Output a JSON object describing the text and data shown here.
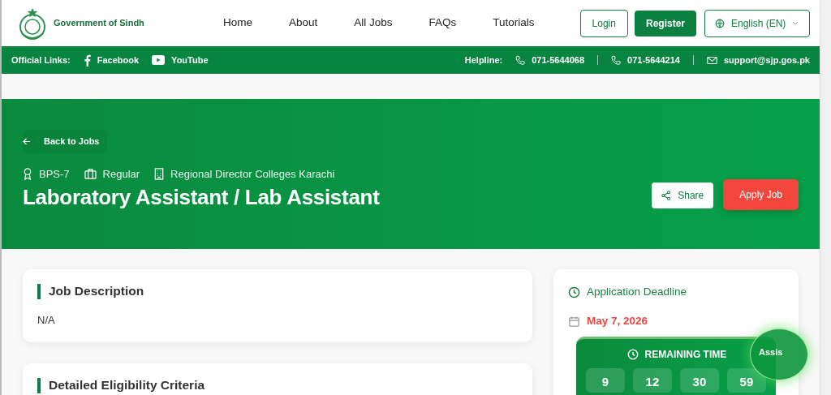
{
  "header": {
    "brand": "Government of Sindh",
    "nav": [
      {
        "label": "Home"
      },
      {
        "label": "About"
      },
      {
        "label": "All Jobs"
      },
      {
        "label": "FAQs"
      },
      {
        "label": "Tutorials"
      }
    ],
    "login": "Login",
    "register": "Register",
    "language": "English (EN)"
  },
  "topbar": {
    "links_label": "Official Links:",
    "links": [
      {
        "kind": "facebook",
        "label": "Facebook"
      },
      {
        "kind": "youtube",
        "label": "YouTube"
      }
    ],
    "helpline_label": "Helpline:",
    "contacts": [
      {
        "kind": "phone",
        "label": "071-5644068"
      },
      {
        "kind": "phone",
        "label": "071-5644214"
      },
      {
        "kind": "email",
        "label": "support@sjp.gos.pk"
      }
    ]
  },
  "hero": {
    "back": "Back to Jobs",
    "meta": [
      {
        "kind": "grade",
        "label": "BPS-7"
      },
      {
        "kind": "type",
        "label": "Regular"
      },
      {
        "kind": "office",
        "label": "Regional Director Colleges Karachi"
      }
    ],
    "title": "Laboratory Assistant / Lab Assistant",
    "share": "Share",
    "apply": "Apply Job"
  },
  "sections": [
    {
      "title": "Job Description",
      "body": "N/A"
    },
    {
      "title": "Detailed Eligibility Criteria"
    }
  ],
  "deadline": {
    "title": "Application Deadline",
    "date": "May 7, 2026",
    "remaining_title": "REMAINING TIME",
    "timer": [
      "9",
      "12",
      "30",
      "59"
    ]
  },
  "assistant": {
    "label": "Assis"
  }
}
